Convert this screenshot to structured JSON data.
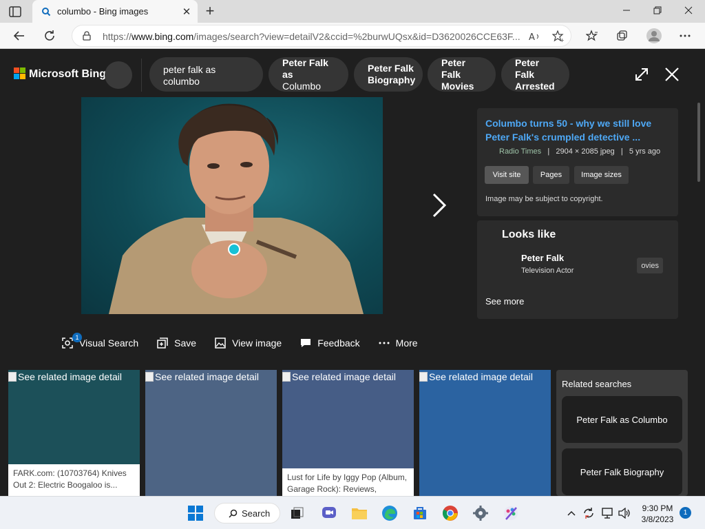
{
  "browser": {
    "tab_title": "columbo - Bing images",
    "url_prefix": "https://",
    "url_host": "www.bing.com",
    "url_rest": "/images/search?view=detailV2&ccid=%2burwUQsx&id=D3620026CCE63F..."
  },
  "header": {
    "brand": "Microsoft Bing",
    "query": "peter falk as columbo",
    "pills": [
      {
        "line1": "Peter Falk as",
        "line2": "Columbo"
      },
      {
        "line1": "Peter Falk",
        "line2": "Biography"
      },
      {
        "line1": "Peter Falk",
        "line2": "Movies"
      },
      {
        "line1": "Peter Falk",
        "line2": "Arrested"
      }
    ]
  },
  "actions": {
    "visual_search": "Visual Search",
    "visual_search_badge": "1",
    "save": "Save",
    "view_image": "View image",
    "feedback": "Feedback",
    "more": "More"
  },
  "info": {
    "title": "Columbo turns 50 - why we still love Peter Falk's crumpled detective ...",
    "source": "Radio Times",
    "dimensions": "2904 × 2085 jpeg",
    "age": "5 yrs ago",
    "sep": "|",
    "buttons": [
      "Visit site",
      "Pages",
      "Image sizes"
    ],
    "copyright": "Image may be subject to copyright."
  },
  "looks_like": {
    "title": "Looks like",
    "name": "Peter Falk",
    "subtitle": "Television Actor",
    "chip": "ovies",
    "see_more": "See more"
  },
  "tiles": [
    {
      "alt": "See related image detail",
      "caption": "FARK.com: (10703764) Knives Out 2: Electric Boogaloo is...",
      "color": "#1c5059"
    },
    {
      "alt": "See related image detail",
      "caption": "",
      "color": "#4d6484"
    },
    {
      "alt": "See related image detail",
      "caption": "Lust for Life by Iggy Pop (Album, Garage Rock): Reviews, Rating...",
      "color": "#465d86"
    },
    {
      "alt": "See related image detail",
      "caption": "",
      "color": "#2b63a1"
    }
  ],
  "related": {
    "title": "Related searches",
    "items": [
      "Peter Falk as Columbo",
      "Peter Falk Biography"
    ]
  },
  "taskbar": {
    "search": "Search",
    "time": "9:30 PM",
    "date": "3/8/2023",
    "notifications": "1"
  },
  "colors": {
    "bing_red": "#f25022",
    "bing_green": "#7fba00",
    "bing_blue": "#00a4ef",
    "bing_yellow": "#ffb900",
    "link_blue": "#4ea8f5"
  }
}
